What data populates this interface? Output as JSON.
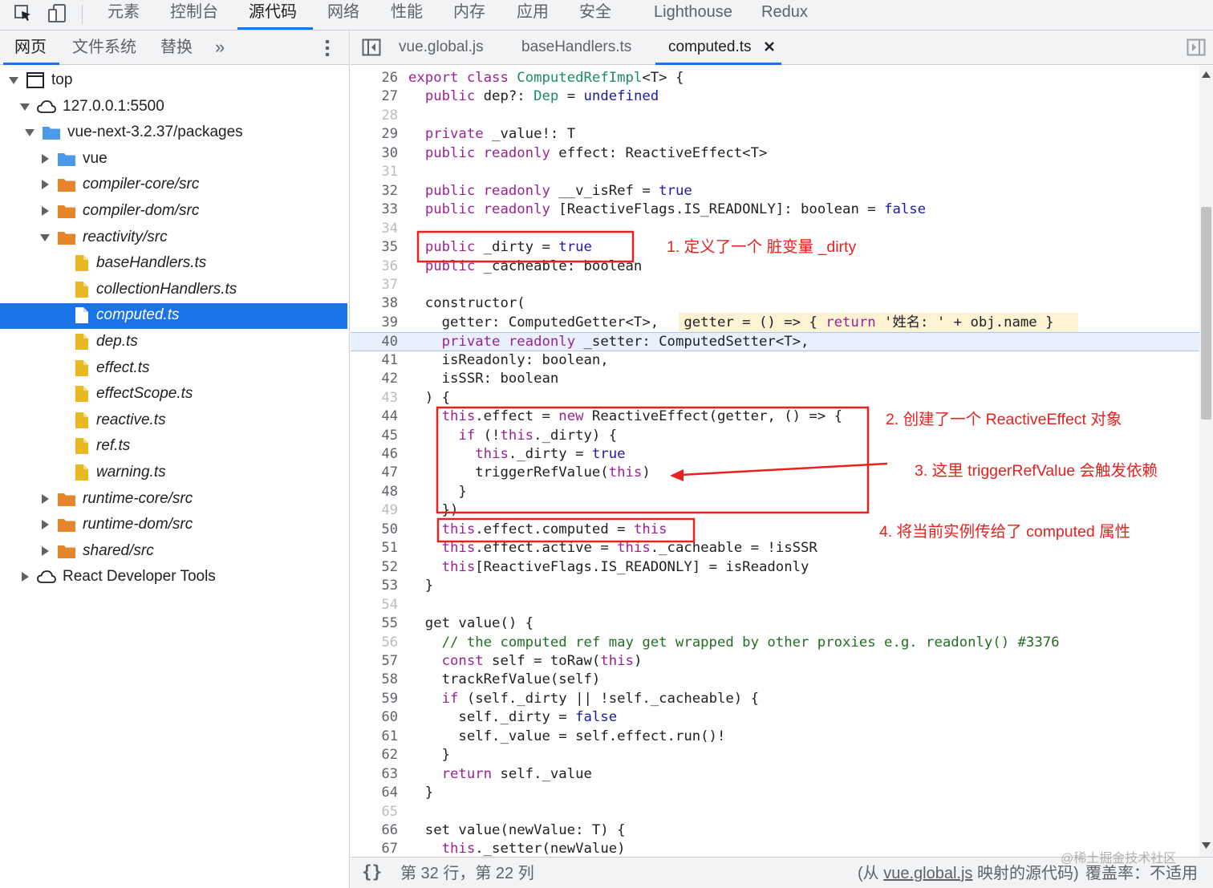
{
  "main_tabs": [
    "元素",
    "控制台",
    "源代码",
    "网络",
    "性能",
    "内存",
    "应用",
    "安全",
    "Lighthouse",
    "Redux"
  ],
  "main_tab_active": "源代码",
  "toolbar_icons": [
    "inspect-element-icon",
    "device-toolbar-icon"
  ],
  "navigator": {
    "tabs": [
      "网页",
      "文件系统",
      "替换"
    ],
    "active_tab": "网页",
    "more_label": "»",
    "tree": [
      {
        "label": "top",
        "icon": "frame-icon",
        "arrow": "down",
        "italic": false
      },
      {
        "label": "127.0.0.1:5500",
        "icon": "cloud-icon",
        "arrow": "down",
        "italic": false
      },
      {
        "label": "vue-next-3.2.37/packages",
        "icon": "folder-icon",
        "folder_color": "#4a9ae8",
        "arrow": "down",
        "italic": false
      },
      {
        "label": "vue",
        "icon": "folder-icon",
        "folder_color": "#4a9ae8",
        "arrow": "right",
        "italic": false
      },
      {
        "label": "compiler-core/src",
        "icon": "folder-icon",
        "folder_color": "#e6862a",
        "arrow": "right",
        "italic": true
      },
      {
        "label": "compiler-dom/src",
        "icon": "folder-icon",
        "folder_color": "#e6862a",
        "arrow": "right",
        "italic": true
      },
      {
        "label": "reactivity/src",
        "icon": "folder-icon",
        "folder_color": "#e6862a",
        "arrow": "down",
        "italic": true
      },
      {
        "label": "baseHandlers.ts",
        "icon": "file-icon",
        "italic": true
      },
      {
        "label": "collectionHandlers.ts",
        "icon": "file-icon",
        "italic": true
      },
      {
        "label": "computed.ts",
        "icon": "file-icon",
        "italic": true,
        "selected": true
      },
      {
        "label": "dep.ts",
        "icon": "file-icon",
        "italic": true
      },
      {
        "label": "effect.ts",
        "icon": "file-icon",
        "italic": true
      },
      {
        "label": "effectScope.ts",
        "icon": "file-icon",
        "italic": true
      },
      {
        "label": "reactive.ts",
        "icon": "file-icon",
        "italic": true
      },
      {
        "label": "ref.ts",
        "icon": "file-icon",
        "italic": true
      },
      {
        "label": "warning.ts",
        "icon": "file-icon",
        "italic": true
      },
      {
        "label": "runtime-core/src",
        "icon": "folder-icon",
        "folder_color": "#e6862a",
        "arrow": "right",
        "italic": true
      },
      {
        "label": "runtime-dom/src",
        "icon": "folder-icon",
        "folder_color": "#e6862a",
        "arrow": "right",
        "italic": true
      },
      {
        "label": "shared/src",
        "icon": "folder-icon",
        "folder_color": "#e6862a",
        "arrow": "right",
        "italic": true
      },
      {
        "label": "React Developer Tools",
        "icon": "cloud-icon",
        "arrow": "right",
        "italic": false
      }
    ]
  },
  "editor": {
    "tabs": [
      "vue.global.js",
      "baseHandlers.ts",
      "computed.ts"
    ],
    "active_tab": "computed.ts",
    "close_label": "✕",
    "code_lines": [
      {
        "n": "26",
        "text": "export class ComputedRefImpl<T> {"
      },
      {
        "n": "27",
        "text": "  public dep?: Dep = undefined"
      },
      {
        "n": "28",
        "text": ""
      },
      {
        "n": "29",
        "text": "  private _value!: T"
      },
      {
        "n": "30",
        "text": "  public readonly effect: ReactiveEffect<T>"
      },
      {
        "n": "31",
        "text": ""
      },
      {
        "n": "32",
        "text": "  public readonly __v_isRef = true"
      },
      {
        "n": "33",
        "text": "  public readonly [ReactiveFlags.IS_READONLY]: boolean = false"
      },
      {
        "n": "34",
        "text": ""
      },
      {
        "n": "35",
        "text": "  public _dirty = true"
      },
      {
        "n": "36",
        "text": "  public _cacheable: boolean"
      },
      {
        "n": "37",
        "text": ""
      },
      {
        "n": "38",
        "text": "  constructor("
      },
      {
        "n": "39",
        "text": "    getter: ComputedGetter<T>,   getter = () => { return '姓名: ' + obj.name }"
      },
      {
        "n": "40",
        "text": "    private readonly _setter: ComputedSetter<T>,"
      },
      {
        "n": "41",
        "text": "    isReadonly: boolean,"
      },
      {
        "n": "42",
        "text": "    isSSR: boolean"
      },
      {
        "n": "43",
        "text": "  ) {"
      },
      {
        "n": "44",
        "text": "    this.effect = new ReactiveEffect(getter, () => {"
      },
      {
        "n": "45",
        "text": "      if (!this._dirty) {"
      },
      {
        "n": "46",
        "text": "        this._dirty = true"
      },
      {
        "n": "47",
        "text": "        triggerRefValue(this)"
      },
      {
        "n": "48",
        "text": "      }"
      },
      {
        "n": "49",
        "text": "    })"
      },
      {
        "n": "50",
        "text": "    this.effect.computed = this"
      },
      {
        "n": "51",
        "text": "    this.effect.active = this._cacheable = !isSSR"
      },
      {
        "n": "52",
        "text": "    this[ReactiveFlags.IS_READONLY] = isReadonly"
      },
      {
        "n": "53",
        "text": "  }"
      },
      {
        "n": "54",
        "text": ""
      },
      {
        "n": "55",
        "text": "  get value() {"
      },
      {
        "n": "56",
        "text": "    // the computed ref may get wrapped by other proxies e.g. readonly() #3376"
      },
      {
        "n": "57",
        "text": "    const self = toRaw(this)"
      },
      {
        "n": "58",
        "text": "    trackRefValue(self)"
      },
      {
        "n": "59",
        "text": "    if (self._dirty || !self._cacheable) {"
      },
      {
        "n": "60",
        "text": "      self._dirty = false"
      },
      {
        "n": "61",
        "text": "      self._value = self.effect.run()!"
      },
      {
        "n": "62",
        "text": "    }"
      },
      {
        "n": "63",
        "text": "    return self._value"
      },
      {
        "n": "64",
        "text": "  }"
      },
      {
        "n": "65",
        "text": ""
      },
      {
        "n": "66",
        "text": "  set value(newValue: T) {"
      },
      {
        "n": "67",
        "text": "    this._setter(newValue)"
      }
    ],
    "highlighted_line": "40",
    "faint_line_numbers": [
      "28",
      "31",
      "34",
      "36",
      "37",
      "43",
      "49",
      "54",
      "56",
      "65"
    ]
  },
  "annotations": {
    "note1": "1. 定义了一个 脏变量 _dirty",
    "note2": "2. 创建了一个  ReactiveEffect 对象",
    "note3": "3. 这里 triggerRefValue 会触发依赖",
    "note4": "4. 将当前实例传给了 computed 属性",
    "color": "#e8201e"
  },
  "status": {
    "format_label": "{}",
    "position": "第 32 行，第 22 列",
    "source_map_prefix": "(从 ",
    "source_map_file": "vue.global.js",
    "source_map_suffix": " 映射的源代码)",
    "coverage": "覆盖率：不适用"
  },
  "watermark": "@稀土掘金技术社区"
}
